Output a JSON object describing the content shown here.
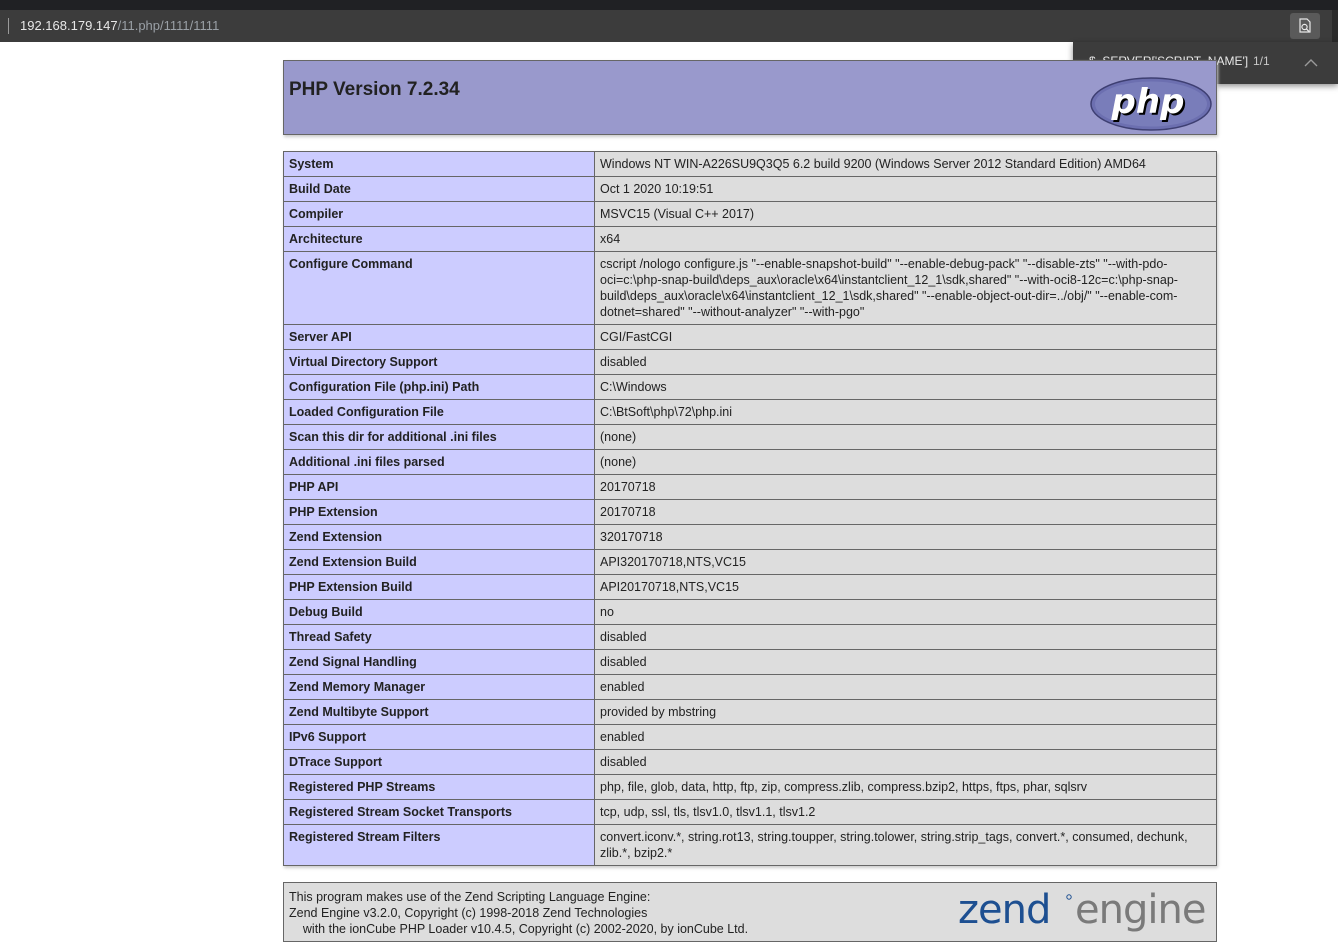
{
  "browser": {
    "address_host": "192.168.179.147",
    "address_path": "/11.php/1111/1111",
    "find_query": "$_SERVER['SCRIPT_NAME']",
    "find_count": "1/1",
    "icons": [
      "zoom-page-icon",
      "chevron-up-icon"
    ]
  },
  "phpinfo": {
    "title": "PHP Version 7.2.34",
    "logo_text": "php",
    "rows": [
      {
        "key": "System",
        "value": "Windows NT WIN-A226SU9Q3Q5 6.2 build 9200 (Windows Server 2012 Standard Edition) AMD64"
      },
      {
        "key": "Build Date",
        "value": "Oct 1 2020 10:19:51"
      },
      {
        "key": "Compiler",
        "value": "MSVC15 (Visual C++ 2017)"
      },
      {
        "key": "Architecture",
        "value": "x64"
      },
      {
        "key": "Configure Command",
        "value": "cscript /nologo configure.js \"--enable-snapshot-build\" \"--enable-debug-pack\" \"--disable-zts\" \"--with-pdo-oci=c:\\php-snap-build\\deps_aux\\oracle\\x64\\instantclient_12_1\\sdk,shared\" \"--with-oci8-12c=c:\\php-snap-build\\deps_aux\\oracle\\x64\\instantclient_12_1\\sdk,shared\" \"--enable-object-out-dir=../obj/\" \"--enable-com-dotnet=shared\" \"--without-analyzer\" \"--with-pgo\""
      },
      {
        "key": "Server API",
        "value": "CGI/FastCGI"
      },
      {
        "key": "Virtual Directory Support",
        "value": "disabled"
      },
      {
        "key": "Configuration File (php.ini) Path",
        "value": "C:\\Windows"
      },
      {
        "key": "Loaded Configuration File",
        "value": "C:\\BtSoft\\php\\72\\php.ini"
      },
      {
        "key": "Scan this dir for additional .ini files",
        "value": "(none)"
      },
      {
        "key": "Additional .ini files parsed",
        "value": "(none)"
      },
      {
        "key": "PHP API",
        "value": "20170718"
      },
      {
        "key": "PHP Extension",
        "value": "20170718"
      },
      {
        "key": "Zend Extension",
        "value": "320170718"
      },
      {
        "key": "Zend Extension Build",
        "value": "API320170718,NTS,VC15"
      },
      {
        "key": "PHP Extension Build",
        "value": "API20170718,NTS,VC15"
      },
      {
        "key": "Debug Build",
        "value": "no"
      },
      {
        "key": "Thread Safety",
        "value": "disabled"
      },
      {
        "key": "Zend Signal Handling",
        "value": "disabled"
      },
      {
        "key": "Zend Memory Manager",
        "value": "enabled"
      },
      {
        "key": "Zend Multibyte Support",
        "value": "provided by mbstring"
      },
      {
        "key": "IPv6 Support",
        "value": "enabled"
      },
      {
        "key": "DTrace Support",
        "value": "disabled"
      },
      {
        "key": "Registered PHP Streams",
        "value": "php, file, glob, data, http, ftp, zip, compress.zlib, compress.bzip2, https, ftps, phar, sqlsrv"
      },
      {
        "key": "Registered Stream Socket Transports",
        "value": "tcp, udp, ssl, tls, tlsv1.0, tlsv1.1, tlsv1.2"
      },
      {
        "key": "Registered Stream Filters",
        "value": "convert.iconv.*, string.rot13, string.toupper, string.tolower, string.strip_tags, convert.*, consumed, dechunk, zlib.*, bzip2.*"
      }
    ],
    "zend": {
      "line1": "This program makes use of the Zend Scripting Language Engine:",
      "line2": "Zend Engine v3.2.0, Copyright (c) 1998-2018 Zend Technologies",
      "line3": "    with the ionCube PHP Loader v10.4.5, Copyright (c) 2002-2020, by ionCube Ltd.",
      "logo_word1": "zend",
      "logo_word2": "engine"
    }
  },
  "colors": {
    "header_bg": "#9999cc",
    "key_bg": "#ccccff",
    "value_bg": "#dddddd",
    "zend_blue": "#1d4f91"
  }
}
